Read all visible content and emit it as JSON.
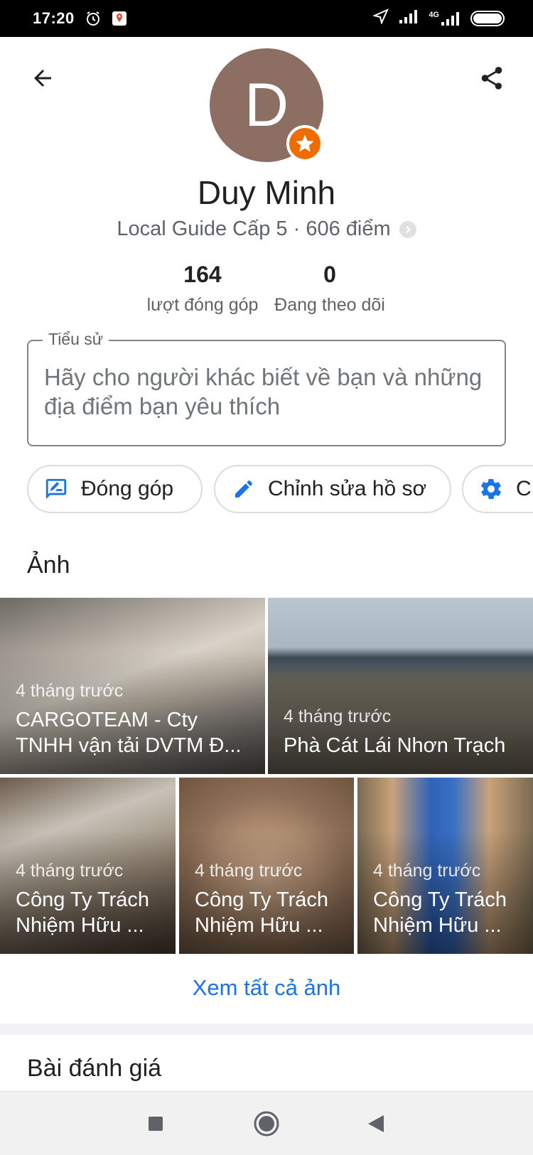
{
  "status_bar": {
    "time": "17:20",
    "network": "4G"
  },
  "profile": {
    "avatar_letter": "D",
    "name": "Duy Minh",
    "level_text": "Local Guide Cấp 5 · 606 điểm",
    "stats": [
      {
        "value": "164",
        "label": "lượt đóng góp"
      },
      {
        "value": "0",
        "label": "Đang theo dõi"
      }
    ]
  },
  "bio": {
    "legend": "Tiểu sử",
    "placeholder": "Hãy cho người khác biết về bạn và những địa điểm bạn yêu thích"
  },
  "actions": [
    {
      "label": "Đóng góp",
      "icon": "feedback-icon"
    },
    {
      "label": "Chỉnh sửa hồ sơ",
      "icon": "pencil-icon"
    },
    {
      "label": "C",
      "icon": "gear-icon"
    }
  ],
  "photos": {
    "title": "Ảnh",
    "items": [
      {
        "ago": "4 tháng trước",
        "place": "CARGOTEAM - Cty TNHH vận tải DVTM Đ..."
      },
      {
        "ago": "4 tháng trước",
        "place": "Phà Cát Lái Nhơn Trạch"
      },
      {
        "ago": "4 tháng trước",
        "place": "Công Ty Trách Nhiệm Hữu ..."
      },
      {
        "ago": "4 tháng trước",
        "place": "Công Ty Trách Nhiệm Hữu ..."
      },
      {
        "ago": "4 tháng trước",
        "place": "Công Ty Trách Nhiệm Hữu ..."
      }
    ],
    "see_all": "Xem tất cả ảnh"
  },
  "reviews": {
    "title": "Bài đánh giá"
  },
  "colors": {
    "accent": "#1a73e8",
    "avatar_bg": "#8d6e63",
    "badge": "#ef6c00"
  }
}
